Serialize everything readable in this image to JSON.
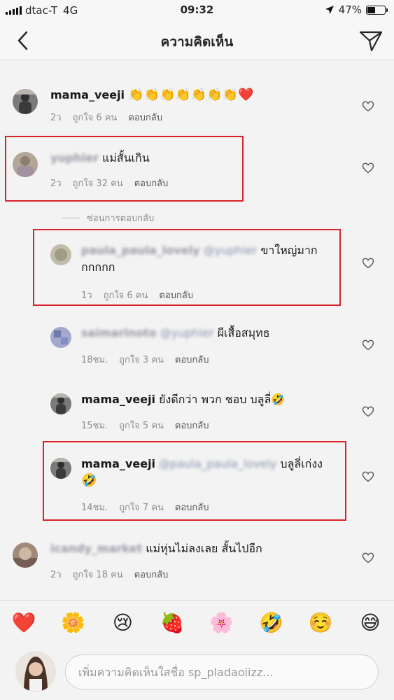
{
  "status_bar": {
    "carrier": "dtac-T",
    "network": "4G",
    "time": "09:32",
    "battery": "47%",
    "battery_level": 0.47
  },
  "header": {
    "title": "ความคิดเห็น",
    "back_icon": "chevron-left-icon",
    "send_icon": "paper-plane-icon"
  },
  "comments": [
    {
      "username": "mama_veeji",
      "username_blurred": false,
      "text": "👏👏👏👏👏👏👏❤️",
      "time": "2ว",
      "likes": "ถูกใจ 6 คน",
      "reply": "ตอบกลับ"
    },
    {
      "username": "yuphier",
      "username_blurred": true,
      "text": "แม่สั้นเกิน",
      "time": "2ว",
      "likes": "ถูกใจ 32 คน",
      "reply": "ตอบกลับ"
    }
  ],
  "hide_replies": "ซ่อนการตอบกลับ",
  "replies": [
    {
      "username": "paula_paula_lovely",
      "mention": "@yuphier",
      "text_line1": "ขาใหญ่มาก",
      "text_line2": "กกกกก",
      "time": "1ว",
      "likes": "ถูกใจ 6 คน",
      "reply": "ตอบกลับ"
    },
    {
      "username": "saimarinoto",
      "mention": "@yuphier",
      "text": "ผีเสื้อสมุทธ",
      "time": "18ชม.",
      "likes": "ถูกใจ 3 คน",
      "reply": "ตอบกลับ"
    },
    {
      "username": "mama_veeji",
      "text": "ยังดีกว่า พวก ชอบ บลูลี่🤣",
      "time": "15ชม.",
      "likes": "ถูกใจ 5 คน",
      "reply": "ตอบกลับ"
    },
    {
      "username": "mama_veeji",
      "mention": "@paula_paula_lovely",
      "text_line1": "บลูลี่เก่งง",
      "text_line2": "🤣",
      "time": "14ชม.",
      "likes": "ถูกใจ 7 คน",
      "reply": "ตอบกลับ"
    }
  ],
  "last_comment": {
    "username": "icandy_market",
    "text": "แม่หุ่นไม่ลงเลย สั้นไปอีก",
    "time": "2ว",
    "likes": "ถูกใจ 18 คน",
    "reply": "ตอบกลับ"
  },
  "emoji_bar": [
    "❤️",
    "🌼",
    "😢",
    "🍓",
    "🌸",
    "🤣",
    "☺️",
    "😅"
  ],
  "input": {
    "placeholder": "เพิ่มความคิดเห็นใสชื่อ sp_pladaoiizz..."
  },
  "colors": {
    "highlight": "#d8232a",
    "background": "#f3f3f3",
    "meta_text": "#8e8e8e"
  }
}
